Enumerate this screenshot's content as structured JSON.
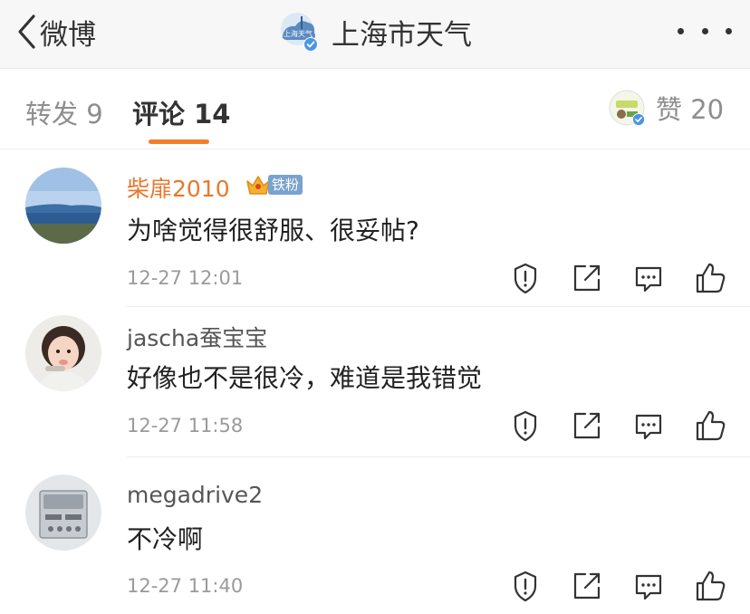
{
  "nav": {
    "back_label": "微博",
    "account_title": "上海市天气",
    "account_logo_text": "上海天气"
  },
  "tabs": {
    "repost": "转发 9",
    "comment": "评论 14",
    "likes": "赞 20"
  },
  "comments": [
    {
      "user": "柴扉2010",
      "badge": "铁粉",
      "text": "为啥觉得很舒服、很妥帖?",
      "time": "12-27 12:01",
      "name_color": "#e8782d"
    },
    {
      "user": "jascha蚕宝宝",
      "text": "好像也不是很冷，难道是我错觉",
      "time": "12-27 11:58",
      "name_color": "#555555"
    },
    {
      "user": "megadrive2",
      "text": "不冷啊",
      "time": "12-27 11:40",
      "name_color": "#555555"
    }
  ],
  "icons": [
    "chevron-left-icon",
    "more-dots-icon",
    "verified-icon",
    "report-icon",
    "share-icon",
    "reply-icon",
    "thumbs-up-icon"
  ],
  "colors": {
    "accent": "#f57e2c",
    "verified": "#4b95e6"
  }
}
